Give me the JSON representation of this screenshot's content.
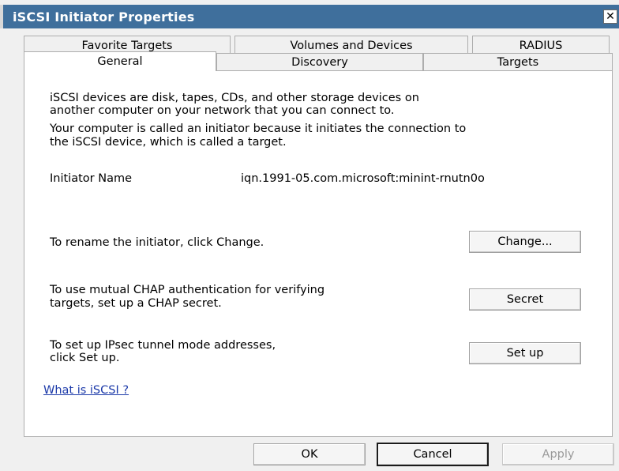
{
  "window": {
    "title": "iSCSI Initiator Properties",
    "close_glyph": "✕"
  },
  "tabs": {
    "row1": [
      {
        "label": "Favorite Targets"
      },
      {
        "label": "Volumes and Devices"
      },
      {
        "label": "RADIUS"
      }
    ],
    "row2": [
      {
        "label": "General",
        "selected": true
      },
      {
        "label": "Discovery"
      },
      {
        "label": "Targets"
      }
    ]
  },
  "general": {
    "intro_line1": "iSCSI devices are disk, tapes, CDs, and other storage devices on",
    "intro_line2": "another computer on your network that you can connect to.",
    "initiator_line1": "Your computer is called an initiator because it initiates the connection to",
    "initiator_line2": "the iSCSI device, which is called a target.",
    "initiator_name_label": "Initiator Name",
    "initiator_name_value": "iqn.1991-05.com.microsoft:minint-rnutn0o",
    "rename_text": "To rename the initiator, click Change.",
    "change_button": "Change...",
    "chap_line1": "To use mutual CHAP authentication for verifying",
    "chap_line2": "targets, set up a CHAP secret.",
    "secret_button": "Secret",
    "ipsec_line1": "To set up IPsec tunnel mode addresses,",
    "ipsec_line2": "click Set up.",
    "setup_button": "Set up",
    "help_link": "What is iSCSI ?"
  },
  "footer": {
    "ok": "OK",
    "cancel": "Cancel",
    "apply": "Apply"
  }
}
